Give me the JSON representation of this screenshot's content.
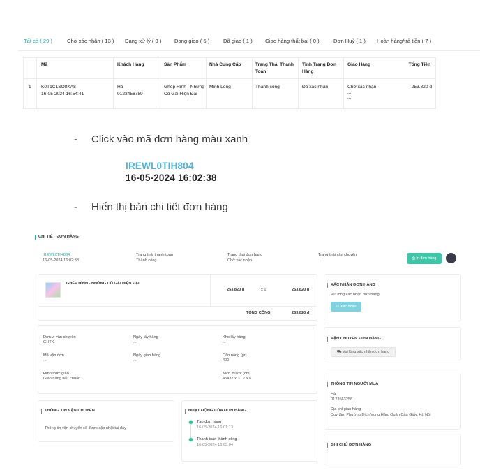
{
  "tabs": [
    {
      "label": "Tất cả ( 29 )",
      "active": true
    },
    {
      "label": "Chờ xác nhận ( 13 )"
    },
    {
      "label": "Đang xử lý ( 3 )"
    },
    {
      "label": "Đang giao ( 5 )"
    },
    {
      "label": "Đã giao ( 1 )"
    },
    {
      "label": "Giao hàng thất bại ( 0 )"
    },
    {
      "label": "Đơn Huỷ ( 1 )"
    },
    {
      "label": "Hoàn hàng/trả tiền ( 7 )"
    }
  ],
  "orders_table": {
    "headers": [
      "Mã",
      "Khách Hàng",
      "Sản Phẩm",
      "Nhà Cung Cấp",
      "Trạng Thái Thanh Toán",
      "Tình Trạng Đơn Hàng",
      "Giao Hàng",
      "Tổng Tiền"
    ],
    "rows": [
      {
        "index": "1",
        "code": "K0T1CLSO8KA8",
        "date": "16-05-2024 16:54:41",
        "customer_name": "Hà",
        "customer_phone": "0123456789",
        "product": "Ghép Hình - Những Cô Gái Hiện Đại",
        "supplier": "Minh Long",
        "payment_status": "Thành công",
        "order_status": "Đã xác nhận",
        "shipping": "Chờ xác nhận",
        "shipping_extra": "...",
        "shipping_extra2": "...",
        "total": "253.820 đ"
      }
    ]
  },
  "instructions": {
    "step1": "Click vào mã đơn hàng màu xanh",
    "example_code": "IREWL0TIH804",
    "example_date": "16-05-2024 16:02:38",
    "step2": "Hiển thị bản chi tiết đơn hàng"
  },
  "detail": {
    "title": "CHI TIẾT ĐƠN HÀNG",
    "order_code": "IREWL0TIH804",
    "order_date": "16-05-2024 16:02:38",
    "payment_status_label": "Trạng thái thanh toán",
    "payment_status_value": "Thành công",
    "order_status_label": "Trạng thái đơn hàng",
    "order_status_value": "Chờ xác nhận",
    "shipping_status_label": "Trạng thái vận chuyển",
    "shipping_status_value": "...",
    "print_button": "In đơn hàng",
    "product_name": "GHÉP HÌNH - NHỮNG CÔ GÁI HIỆN ĐẠI",
    "unit_price": "253.820 đ",
    "quantity": "x 1",
    "line_total": "253.820 đ",
    "grand_total_label": "TỔNG CỘNG",
    "grand_total": "253.820 đ",
    "confirm_section_title": "XÁC NHẬN ĐƠN HÀNG",
    "confirm_hint": "Vui lòng xác nhận đơn hàng",
    "confirm_button": "Xác nhận",
    "shipping_section_title": "VẬN CHUYỂN ĐƠN HÀNG",
    "shipping_hint_button": "Vui lòng xác nhận đơn hàng",
    "buyer_section_title": "THÔNG TIN NGƯỜI MUA",
    "buyer_name": "Hà",
    "buyer_phone": "0123563258",
    "delivery_address_label": "Địa chỉ giao hàng",
    "delivery_address": "Duy tân, Phường Dịch Vọng Hậu, Quận Cầu Giấy, Hà Nội",
    "note_section_title": "GHI CHÚ ĐƠN HÀNG",
    "shipping_info": {
      "carrier_label": "Đơn vị vận chuyển",
      "carrier_value": "GHTK",
      "pickup_date_label": "Ngày lấy hàng",
      "pickup_date_value": "...",
      "warehouse_label": "Kho lấy hàng",
      "warehouse_value": "...",
      "waybill_label": "Mã vận đơn",
      "waybill_value": "...",
      "delivery_date_label": "Ngày giao hàng",
      "delivery_date_value": "...",
      "weight_label": "Cân nặng (gr)",
      "weight_value": "400",
      "method_label": "Hình thức giao",
      "method_value": "Giao hàng tiêu chuẩn",
      "size_label": "Kích thước (cm)",
      "size_value": "45437 x 37.7 x 6"
    },
    "transport_info_title": "THÔNG TIN VẬN CHUYỂN",
    "transport_info_text": "Thông tin vận chuyển sẽ được cập nhật tại đây",
    "activity_title": "HOẠT ĐỘNG CỦA ĐƠN HÀNG",
    "activities": [
      {
        "label": "Tạo đơn hàng",
        "time": "16-05-2024 16:01:13"
      },
      {
        "label": "Thanh toán thành công",
        "time": "16-05-2024 16:03:04"
      }
    ]
  },
  "colors": {
    "accent": "#20b2aa",
    "link": "#4fb3d9",
    "button": "#3ec6a8"
  }
}
